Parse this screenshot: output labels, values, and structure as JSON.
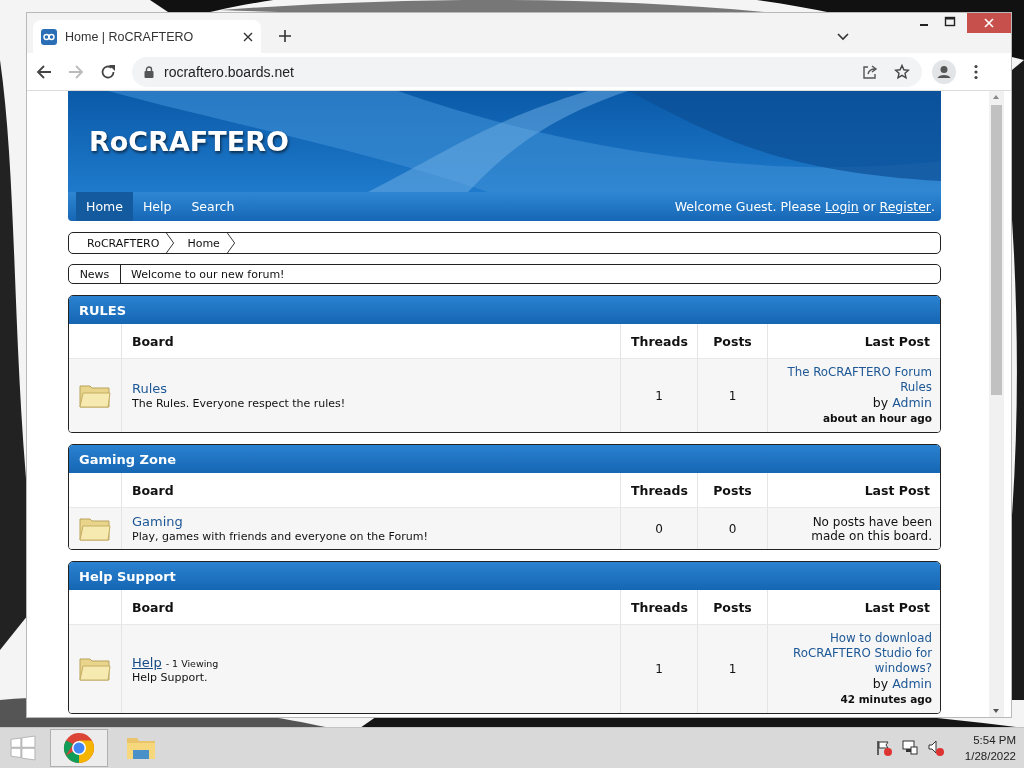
{
  "browser": {
    "tab_title": "Home | RoCRAFTERO",
    "address": "rocraftero.boards.net"
  },
  "forum": {
    "title": "RoCRAFTERO",
    "nav": [
      {
        "label": "Home",
        "selected": true
      },
      {
        "label": "Help",
        "selected": false
      },
      {
        "label": "Search",
        "selected": false
      }
    ],
    "welcome": {
      "prefix": "Welcome Guest. Please",
      "login": "Login",
      "middle": "or",
      "register": "Register",
      "suffix": "."
    },
    "breadcrumbs": [
      "RoCRAFTERO",
      "Home"
    ],
    "news": {
      "label": "News",
      "text": "Welcome to our new forum!"
    },
    "categories": [
      {
        "title": "RULES",
        "columns": [
          "Board",
          "Threads",
          "Posts",
          "Last Post"
        ],
        "boards": [
          {
            "name": "Rules",
            "hovered": false,
            "description": "The Rules. Everyone respect the rules!",
            "threads": "1",
            "posts": "1",
            "last_post": {
              "kind": "post",
              "title": "The RoCRAFTERO Forum Rules",
              "by": "by",
              "author": "Admin",
              "time": "about an hour ago"
            }
          }
        ]
      },
      {
        "title": "Gaming Zone",
        "columns": [
          "Board",
          "Threads",
          "Posts",
          "Last Post"
        ],
        "boards": [
          {
            "name": "Gaming",
            "hovered": false,
            "description": "Play, games with friends and everyone on the Forum!",
            "threads": "0",
            "posts": "0",
            "last_post": {
              "kind": "none",
              "text": "No posts have been made on this board."
            }
          }
        ]
      },
      {
        "title": "Help Support",
        "columns": [
          "Board",
          "Threads",
          "Posts",
          "Last Post"
        ],
        "boards": [
          {
            "name": "Help",
            "hovered": true,
            "viewing": "- 1 Viewing",
            "description": "Help Support.",
            "threads": "1",
            "posts": "1",
            "last_post": {
              "kind": "post",
              "title": "How to download RoCRAFTERO Studio for windows?",
              "by": "by",
              "author": "Admin",
              "time": "42 minutes ago"
            }
          }
        ]
      }
    ]
  },
  "taskbar": {
    "time": "5:54 PM",
    "date": "1/28/2022"
  }
}
